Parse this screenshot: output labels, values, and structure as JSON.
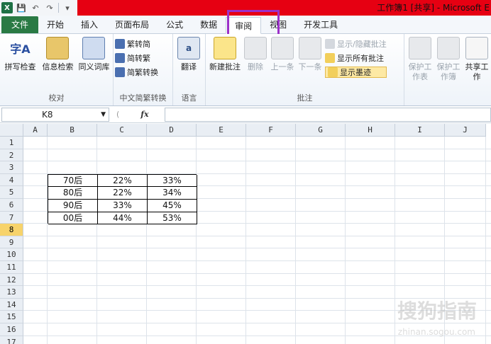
{
  "titlebar": {
    "title": "工作簿1 [共享] - Microsoft E",
    "qa_icons": [
      "excel-logo-icon",
      "save-icon",
      "undo-icon",
      "redo-icon",
      "customize-icon"
    ]
  },
  "tabs": [
    {
      "label": "文件",
      "kind": "file"
    },
    {
      "label": "开始"
    },
    {
      "label": "插入"
    },
    {
      "label": "页面布局"
    },
    {
      "label": "公式"
    },
    {
      "label": "数据"
    },
    {
      "label": "审阅",
      "active": true
    },
    {
      "label": "视图"
    },
    {
      "label": "开发工具"
    }
  ],
  "ribbon": {
    "proofing": {
      "label": "校对",
      "spell": "拼写检查",
      "research": "信息检索",
      "thesaurus": "同义词库"
    },
    "chinese": {
      "label": "中文简繁转换",
      "to_simplified": "繁转简",
      "to_traditional": "简转繁",
      "convert": "简繁转换"
    },
    "language": {
      "label": "语言",
      "translate": "翻译"
    },
    "comments": {
      "label": "批注",
      "new": "新建批注",
      "delete": "删除",
      "prev": "上一条",
      "next": "下一条",
      "show_hide": "显示/隐藏批注",
      "show_all": "显示所有批注",
      "show_ink": "显示墨迹"
    },
    "changes": {
      "protect_sheet": "保护工作表",
      "protect_workbook": "保护工作簿",
      "share": "共享工作"
    }
  },
  "formula_bar": {
    "name_box": "K8",
    "fx": "fx",
    "formula": ""
  },
  "sheet": {
    "columns": [
      "A",
      "B",
      "C",
      "D",
      "E",
      "F",
      "G",
      "H",
      "I",
      "J"
    ],
    "rows": [
      "1",
      "2",
      "3",
      "4",
      "5",
      "6",
      "7",
      "8",
      "9",
      "10",
      "11",
      "12",
      "13",
      "14",
      "15",
      "16",
      "17"
    ],
    "selected_row": "8",
    "table": [
      [
        "70后",
        "22%",
        "33%"
      ],
      [
        "80后",
        "22%",
        "34%"
      ],
      [
        "90后",
        "33%",
        "45%"
      ],
      [
        "00后",
        "44%",
        "53%"
      ]
    ]
  },
  "watermark": {
    "main": "搜狗指南",
    "sub": "zhinan.sogou.com"
  }
}
